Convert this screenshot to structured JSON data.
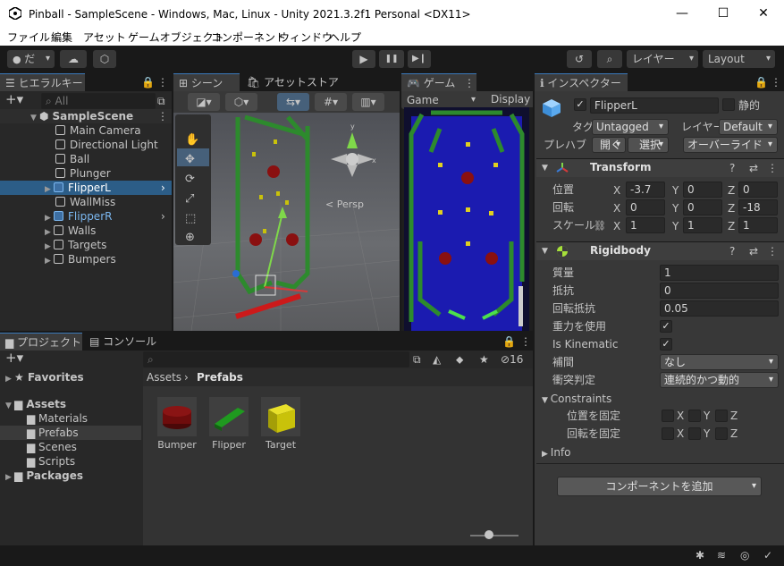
{
  "window": {
    "title": "Pinball - SampleScene - Windows, Mac, Linux - Unity 2021.3.2f1 Personal <DX11>",
    "minimize": "—",
    "maximize": "☐",
    "close": "✕"
  },
  "menu": [
    "ファイル",
    "編集",
    "アセット",
    "ゲームオブジェクト",
    "コンポーネント",
    "ウィンドウ",
    "ヘルプ"
  ],
  "toolbar": {
    "account": "だ",
    "layers": "レイヤー",
    "layout": "Layout",
    "play": "▶",
    "pause": "❚❚",
    "step": "▶❙"
  },
  "hierarchy": {
    "tab": "ヒエラルキー",
    "search_placeholder": "All",
    "scene": "SampleScene",
    "items": [
      "Main Camera",
      "Directional Light",
      "Ball",
      "Plunger",
      "FlipperL",
      "WallMiss",
      "FlipperR",
      "Walls",
      "Targets",
      "Bumpers"
    ]
  },
  "scene": {
    "tab": "シーン",
    "asset_store": "アセットストア",
    "persp": "< Persp",
    "gizmo_y": "y",
    "gizmo_x": "x",
    "scale_label": "Display"
  },
  "game": {
    "tab": "ゲーム",
    "mode": "Game",
    "display": "Display"
  },
  "project": {
    "tab": "プロジェクト",
    "console": "コンソール",
    "count": "16",
    "favorites": "Favorites",
    "assets": "Assets",
    "folders": [
      "Materials",
      "Prefabs",
      "Scenes",
      "Scripts"
    ],
    "packages": "Packages",
    "breadcrumb_root": "Assets",
    "breadcrumb_current": "Prefabs",
    "assets_list": [
      {
        "name": "Bumper",
        "color": "#7a0c0c"
      },
      {
        "name": "Flipper",
        "color": "#1f9a1f"
      },
      {
        "name": "Target",
        "color": "#c9c20a"
      }
    ]
  },
  "inspector": {
    "tab": "インスペクター",
    "name": "FlipperL",
    "static": "静的",
    "tag_label": "タグ",
    "tag": "Untagged",
    "layer_label": "レイヤー",
    "layer": "Default",
    "prefab_label": "プレハブ",
    "open": "開く",
    "select": "選択",
    "override": "オーバーライド",
    "transform": {
      "title": "Transform",
      "position_label": "位置",
      "rotation_label": "回転",
      "scale_label": "スケール",
      "position": {
        "x": "-3.7",
        "y": "0",
        "z": "0"
      },
      "rotation": {
        "x": "0",
        "y": "0",
        "z": "-18"
      },
      "scale": {
        "x": "1",
        "y": "1",
        "z": "1"
      }
    },
    "rigidbody": {
      "title": "Rigidbody",
      "mass_label": "質量",
      "mass": "1",
      "drag_label": "抵抗",
      "drag": "0",
      "angular_label": "回転抵抗",
      "angular": "0.05",
      "gravity_label": "重力を使用",
      "kinematic_label": "Is Kinematic",
      "interp_label": "補間",
      "interp": "なし",
      "collision_label": "衝突判定",
      "collision": "連続的かつ動的",
      "constraints": "Constraints",
      "freeze_pos": "位置を固定",
      "freeze_rot": "回転を固定",
      "x": "X",
      "y": "Y",
      "z": "Z",
      "info": "Info"
    },
    "add_component": "コンポーネントを追加"
  }
}
